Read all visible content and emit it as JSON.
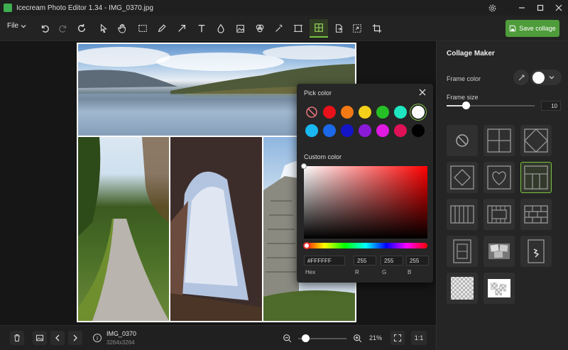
{
  "window": {
    "title": "Icecream Photo Editor 1.34 - IMG_0370.jpg"
  },
  "toolbar": {
    "file_label": "File",
    "save_label": "Save collage"
  },
  "picker": {
    "title": "Pick color",
    "custom_label": "Custom color",
    "hex_value": "#FFFFFF",
    "r_value": "255",
    "g_value": "255",
    "b_value": "255",
    "hex_label": "Hex",
    "r_label": "R",
    "g_label": "G",
    "b_label": "B",
    "swatch_colors_row1": [
      "none",
      "#e8111a",
      "#f27a14",
      "#f3d01a",
      "#25c026",
      "#1fe6c0",
      "#ffffff"
    ],
    "swatch_colors_row2": [
      "#19b8f0",
      "#1b69e8",
      "#1515c8",
      "#8b1ad8",
      "#e01ae0",
      "#e01257",
      "#000000"
    ],
    "selected_swatch": "#ffffff"
  },
  "panel": {
    "title": "Collage Maker",
    "frame_color_label": "Frame color",
    "frame_size_label": "Frame size",
    "frame_size_value": "10",
    "frame_size_level": 0.22
  },
  "bottom": {
    "file_name": "IMG_0370",
    "dimensions": "3264x3264",
    "zoom": "21%",
    "zoom_level": 0.15,
    "one_to_one": "1:1"
  },
  "colors": {
    "accent": "#4f9c3b",
    "selected_border": "#7cc242"
  }
}
